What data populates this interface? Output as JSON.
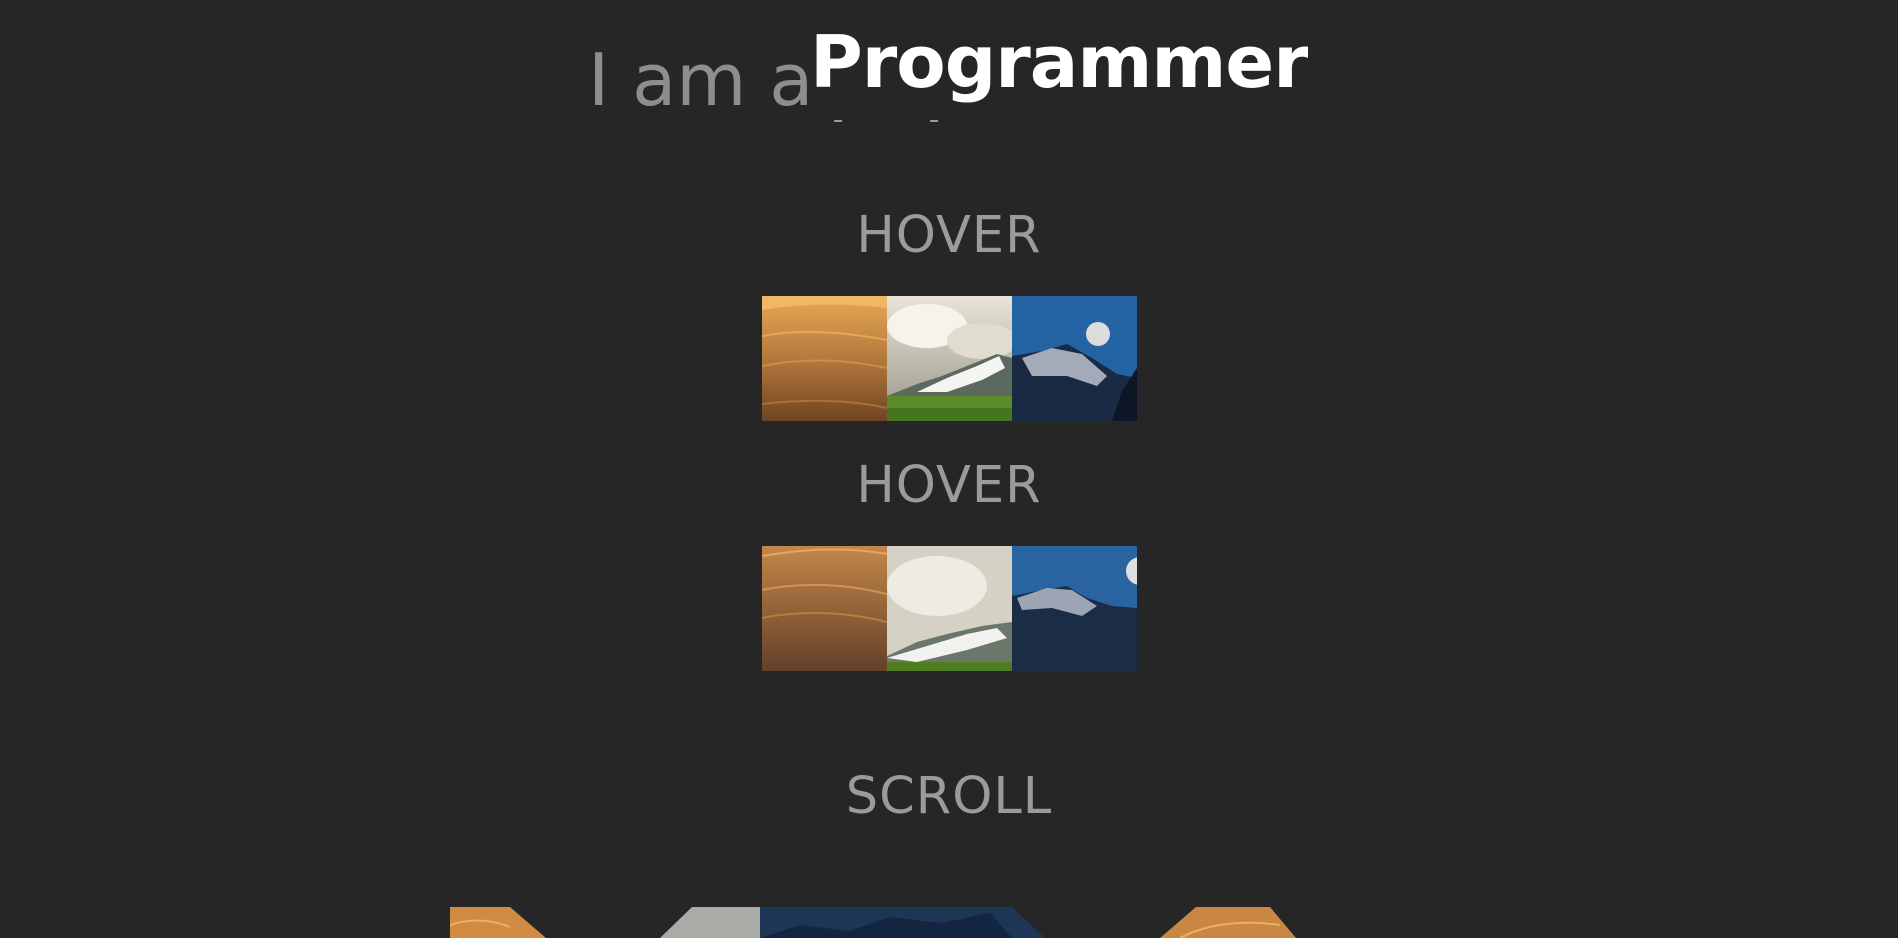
{
  "headline": {
    "prefix": "I am a",
    "word": "Programmer"
  },
  "sections": {
    "hover_1_label": "HOVER",
    "hover_2_label": "HOVER",
    "scroll_label": "SCROLL"
  },
  "images": {
    "desert": "desert dunes",
    "mountain_meadow": "mountain meadow",
    "moon_mountain": "moonlit mountain"
  },
  "colors": {
    "background": "#262626",
    "label_gray": "#9b9b9b",
    "headline_white": "#ffffff"
  }
}
